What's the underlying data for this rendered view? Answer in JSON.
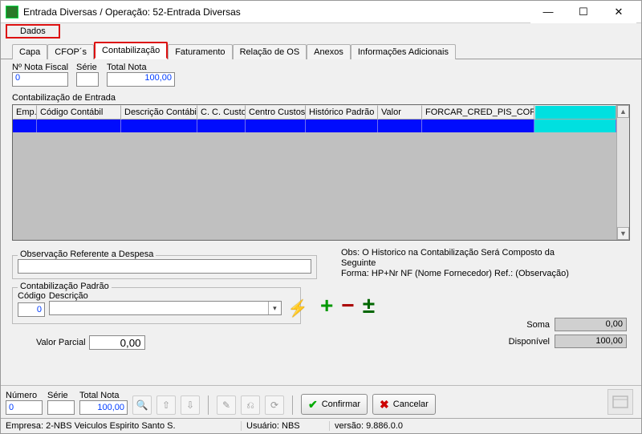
{
  "window": {
    "title": "Entrada Diversas / Operação: 52-Entrada Diversas"
  },
  "menubar": {
    "dados": "Dados"
  },
  "tabs": {
    "capa": "Capa",
    "cfops": "CFOP´s",
    "contab": "Contabilização",
    "fatur": "Faturamento",
    "relos": "Relação de OS",
    "anexos": "Anexos",
    "info": "Informações Adicionais"
  },
  "top": {
    "nf_lbl": "Nº Nota Fiscal",
    "nf_val": "0",
    "serie_lbl": "Série",
    "serie_val": "",
    "tot_lbl": "Total Nota",
    "tot_val": "100,00"
  },
  "grid": {
    "caption": "Contabilização de Entrada",
    "cols": {
      "emp": "Emp.",
      "codcont": "Código Contábil",
      "desccont": "Descrição Contábil",
      "cccusto": "C. C. Custo",
      "centrocustos": "Centro Custos",
      "histpad": "Histórico Padrão",
      "valor": "Valor",
      "forcar": "FORCAR_CRED_PIS_COFINS"
    }
  },
  "obs": {
    "legend": "Observação Referente a Despesa",
    "note1": "Obs: O Historico na Contabilização Será Composto da Seguinte",
    "note2": "Forma: HP+Nr NF (Nome Fornecedor) Ref.: (Observação)"
  },
  "contapad": {
    "legend": "Contabilização Padrão",
    "cod_lbl": "Código",
    "cod_val": "0",
    "desc_lbl": "Descrição"
  },
  "totals": {
    "soma_lbl": "Soma",
    "soma_val": "0,00",
    "disp_lbl": "Disponível",
    "disp_val": "100,00"
  },
  "vp": {
    "lbl": "Valor Parcial",
    "val": "0,00"
  },
  "bottom": {
    "num_lbl": "Número",
    "num_val": "0",
    "serie_lbl": "Série",
    "serie_val": "",
    "tot_lbl": "Total Nota",
    "tot_val": "100,00",
    "confirm": "Confirmar",
    "cancel": "Cancelar"
  },
  "status": {
    "empresa": "Empresa: 2-NBS Veiculos Espirito Santo S.",
    "usuario": "Usuário: NBS",
    "versao": "versão: 9.886.0.0"
  }
}
